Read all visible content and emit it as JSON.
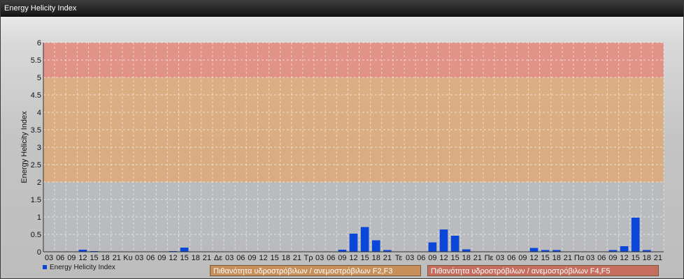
{
  "window": {
    "title": "Energy Helicity Index"
  },
  "colors": {
    "bar": "#0a46d8",
    "band_low": "#b8babd",
    "band_mid": "#dea877",
    "band_high": "#e3877a",
    "grid": "#ffffff"
  },
  "chart_data": {
    "type": "bar",
    "ylabel": "Energy Helicity Index",
    "ylim": [
      0,
      6
    ],
    "yticks": [
      "0",
      "0.5",
      "1",
      "1.5",
      "2",
      "2.5",
      "3",
      "3.5",
      "4",
      "4.5",
      "5",
      "5.5",
      "6"
    ],
    "grid": true,
    "bands": [
      {
        "from": 0,
        "to": 2,
        "color": "#b8babd"
      },
      {
        "from": 2,
        "to": 5,
        "color": "#dea877"
      },
      {
        "from": 5,
        "to": 6,
        "color": "#e3877a"
      }
    ],
    "categories": [
      "03",
      "06",
      "09",
      "12",
      "15",
      "18",
      "21",
      "Κυ",
      "03",
      "06",
      "09",
      "12",
      "15",
      "18",
      "21",
      "Δε",
      "03",
      "06",
      "09",
      "12",
      "15",
      "18",
      "21",
      "Τρ",
      "03",
      "06",
      "09",
      "12",
      "15",
      "18",
      "21",
      "Τε",
      "03",
      "06",
      "09",
      "12",
      "15",
      "18",
      "21",
      "Πε",
      "03",
      "06",
      "09",
      "12",
      "15",
      "18",
      "21",
      "Πα",
      "03",
      "06",
      "09",
      "12",
      "15",
      "18",
      "21"
    ],
    "series": [
      {
        "name": "Energy Helicity Index",
        "values": [
          0.01,
          0.01,
          0.01,
          0.06,
          0.02,
          0.01,
          0.01,
          0.01,
          0.01,
          0.01,
          0.01,
          0.02,
          0.12,
          0.01,
          0.01,
          0.01,
          0.01,
          0.01,
          0.01,
          0.01,
          0.01,
          0.01,
          0.01,
          0.01,
          0.01,
          0.01,
          0.06,
          0.52,
          0.71,
          0.33,
          0.05,
          0.01,
          0.01,
          0.01,
          0.27,
          0.64,
          0.46,
          0.07,
          0.01,
          0.01,
          0.01,
          0.01,
          0.01,
          0.11,
          0.05,
          0.05,
          0.01,
          0.01,
          0.01,
          0.01,
          0.05,
          0.16,
          0.98,
          0.05,
          0.01
        ]
      }
    ]
  },
  "legend": {
    "series_label": "Energy Helicity Index",
    "band_orange": "Πιθανότητα υδροστρόβιλων / ανεμοστρόβιλων F2,F3",
    "band_red": "Πιθανότητα υδροστρόβιλων / ανεμοστρόβιλων F4,F5"
  }
}
